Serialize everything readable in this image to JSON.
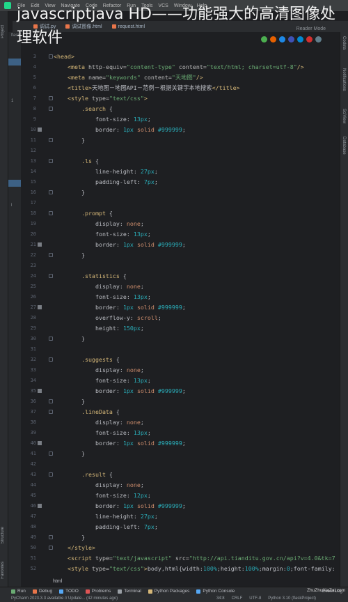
{
  "overlay_title": "javascriptjava HD——功能强大的高清图像处理软件",
  "menubar": {
    "items": [
      "File",
      "Edit",
      "View",
      "Navigate",
      "Code",
      "Refactor",
      "Run",
      "Tools",
      "VCS",
      "Window",
      "Help"
    ]
  },
  "tabs": [
    {
      "label": "调试.py"
    },
    {
      "label": "调试图像.html"
    },
    {
      "label": "request.html"
    }
  ],
  "left_strip": {
    "labels": [
      "Project",
      "Structure",
      "Favorites"
    ],
    "project_items": [
      "flaskP",
      "1",
      "l"
    ]
  },
  "right_strip": {
    "labels": [
      "Codota",
      "Notifications",
      "SciView",
      "Database"
    ]
  },
  "editor": {
    "reader_mode": "Reader Mode",
    "browser_icons": [
      "chrome-icon",
      "firefox-icon",
      "safari-icon",
      "edge-icon",
      "ie-icon",
      "opera-icon",
      "browser-icon"
    ],
    "browser_colors": [
      "#4caf50",
      "#e66000",
      "#1e88e5",
      "#3f51b5",
      "#0288d1",
      "#d32f2f",
      "#607d8b"
    ],
    "breadcrumb": "html",
    "lines": [
      {
        "n": "3",
        "fold": true,
        "bp": false,
        "html": "<span class='tag'>&lt;head&gt;</span>"
      },
      {
        "n": "4",
        "fold": false,
        "bp": false,
        "html": "    <span class='tag'>&lt;meta</span> <span class='attr'>http-equiv=</span><span class='str'>\"content-type\"</span> <span class='attr'>content=</span><span class='str'>\"text/html; charset=utf-8\"</span><span class='tag'>/&gt;</span>"
      },
      {
        "n": "5",
        "fold": false,
        "bp": false,
        "html": "    <span class='tag'>&lt;meta</span> <span class='attr'>name=</span><span class='str'>\"keywords\"</span> <span class='attr'>content=</span><span class='str'>\"天地图\"</span><span class='tag'>/&gt;</span>"
      },
      {
        "n": "6",
        "fold": false,
        "bp": false,
        "html": "    <span class='tag'>&lt;title&gt;</span>天地图－地图API－范例－根据关键字本地搜索<span class='tag'>&lt;/title&gt;</span>"
      },
      {
        "n": "7",
        "fold": true,
        "bp": false,
        "html": "    <span class='tag'>&lt;style</span> <span class='attr'>type=</span><span class='str'>\"text/css\"</span><span class='tag'>&gt;</span>"
      },
      {
        "n": "8",
        "fold": true,
        "bp": false,
        "html": "        <span class='sel'>.search</span> {"
      },
      {
        "n": "9",
        "fold": false,
        "bp": false,
        "html": "            <span class='prop'>font-size</span>: <span class='num'>13px</span>;"
      },
      {
        "n": "10",
        "fold": false,
        "bp": true,
        "html": "            <span class='prop'>border</span>: <span class='num'>1px</span> <span class='kw'>solid</span> <span class='hex'>#999999</span>;"
      },
      {
        "n": "11",
        "fold": true,
        "bp": false,
        "html": "        }"
      },
      {
        "n": "12",
        "fold": false,
        "bp": false,
        "html": ""
      },
      {
        "n": "13",
        "fold": true,
        "bp": false,
        "html": "        <span class='sel'>.ls</span> {"
      },
      {
        "n": "14",
        "fold": false,
        "bp": false,
        "html": "            <span class='prop'>line-height</span>: <span class='num'>27px</span>;"
      },
      {
        "n": "15",
        "fold": false,
        "bp": false,
        "html": "            <span class='prop'>padding-left</span>: <span class='num'>7px</span>;"
      },
      {
        "n": "16",
        "fold": true,
        "bp": false,
        "html": "        }"
      },
      {
        "n": "17",
        "fold": false,
        "bp": false,
        "html": ""
      },
      {
        "n": "18",
        "fold": true,
        "bp": false,
        "html": "        <span class='sel'>.prompt</span> {"
      },
      {
        "n": "19",
        "fold": false,
        "bp": false,
        "html": "            <span class='prop'>display</span>: <span class='kw'>none</span>;"
      },
      {
        "n": "20",
        "fold": false,
        "bp": false,
        "html": "            <span class='prop'>font-size</span>: <span class='num'>13px</span>;"
      },
      {
        "n": "21",
        "fold": false,
        "bp": true,
        "html": "            <span class='prop'>border</span>: <span class='num'>1px</span> <span class='kw'>solid</span> <span class='hex'>#999999</span>;"
      },
      {
        "n": "22",
        "fold": true,
        "bp": false,
        "html": "        }"
      },
      {
        "n": "23",
        "fold": false,
        "bp": false,
        "html": ""
      },
      {
        "n": "24",
        "fold": true,
        "bp": false,
        "html": "        <span class='sel'>.statistics</span> {"
      },
      {
        "n": "25",
        "fold": false,
        "bp": false,
        "html": "            <span class='prop'>display</span>: <span class='kw'>none</span>;"
      },
      {
        "n": "26",
        "fold": false,
        "bp": false,
        "html": "            <span class='prop'>font-size</span>: <span class='num'>13px</span>;"
      },
      {
        "n": "27",
        "fold": false,
        "bp": true,
        "html": "            <span class='prop'>border</span>: <span class='num'>1px</span> <span class='kw'>solid</span> <span class='hex'>#999999</span>;"
      },
      {
        "n": "28",
        "fold": false,
        "bp": false,
        "html": "            <span class='prop'>overflow-y</span>: <span class='kw'>scroll</span>;"
      },
      {
        "n": "29",
        "fold": false,
        "bp": false,
        "html": "            <span class='prop'>height</span>: <span class='num'>150px</span>;"
      },
      {
        "n": "30",
        "fold": true,
        "bp": false,
        "html": "        }"
      },
      {
        "n": "31",
        "fold": false,
        "bp": false,
        "html": ""
      },
      {
        "n": "32",
        "fold": true,
        "bp": false,
        "html": "        <span class='sel'>.suggests</span> {"
      },
      {
        "n": "33",
        "fold": false,
        "bp": false,
        "html": "            <span class='prop'>display</span>: <span class='kw'>none</span>;"
      },
      {
        "n": "34",
        "fold": false,
        "bp": false,
        "html": "            <span class='prop'>font-size</span>: <span class='num'>13px</span>;"
      },
      {
        "n": "35",
        "fold": false,
        "bp": true,
        "html": "            <span class='prop'>border</span>: <span class='num'>1px</span> <span class='kw'>solid</span> <span class='hex'>#999999</span>;"
      },
      {
        "n": "36",
        "fold": true,
        "bp": false,
        "html": "        }"
      },
      {
        "n": "37",
        "fold": true,
        "bp": false,
        "html": "        <span class='sel'>.lineData</span> {"
      },
      {
        "n": "38",
        "fold": false,
        "bp": false,
        "html": "            <span class='prop'>display</span>: <span class='kw'>none</span>;"
      },
      {
        "n": "39",
        "fold": false,
        "bp": false,
        "html": "            <span class='prop'>font-size</span>: <span class='num'>13px</span>;"
      },
      {
        "n": "40",
        "fold": false,
        "bp": true,
        "html": "            <span class='prop'>border</span>: <span class='num'>1px</span> <span class='kw'>solid</span> <span class='hex'>#999999</span>;"
      },
      {
        "n": "41",
        "fold": true,
        "bp": false,
        "html": "        }"
      },
      {
        "n": "42",
        "fold": false,
        "bp": false,
        "html": ""
      },
      {
        "n": "43",
        "fold": true,
        "bp": false,
        "html": "        <span class='sel'>.result</span> {"
      },
      {
        "n": "44",
        "fold": false,
        "bp": false,
        "html": "            <span class='prop'>display</span>: <span class='kw'>none</span>;"
      },
      {
        "n": "45",
        "fold": false,
        "bp": false,
        "html": "            <span class='prop'>font-size</span>: <span class='num'>12px</span>;"
      },
      {
        "n": "46",
        "fold": false,
        "bp": true,
        "html": "            <span class='prop'>border</span>: <span class='num'>1px</span> <span class='kw'>solid</span> <span class='hex'>#999999</span>;"
      },
      {
        "n": "47",
        "fold": false,
        "bp": false,
        "html": "            <span class='prop'>line-height</span>: <span class='num'>27px</span>;"
      },
      {
        "n": "48",
        "fold": false,
        "bp": false,
        "html": "            <span class='prop'>padding-left</span>: <span class='num'>7px</span>;"
      },
      {
        "n": "49",
        "fold": true,
        "bp": false,
        "html": "        }"
      },
      {
        "n": "50",
        "fold": true,
        "bp": false,
        "html": "    <span class='tag'>&lt;/style&gt;</span>"
      },
      {
        "n": "51",
        "fold": false,
        "bp": false,
        "html": "    <span class='tag'>&lt;script</span> <span class='attr'>type=</span><span class='str'>\"text/javascript\"</span> <span class='attr'>src=</span><span class='str'>\"http://api.tianditu.gov.cn/api?v=4.0&amp;tk=7</span>"
      },
      {
        "n": "52",
        "fold": false,
        "bp": false,
        "html": "    <span class='tag'>&lt;style</span> <span class='attr'>type=</span><span class='str'>\"text/css\"</span><span class='tag'>&gt;</span>body,html{width:<span class='num'>100%</span>;height:<span class='num'>100%</span>;margin:<span class='num'>0</span>;font-family:"
      }
    ]
  },
  "bottom_tools": {
    "items": [
      "Run",
      "Debug",
      "TODO",
      "Problems",
      "Terminal",
      "Python Packages",
      "Python Console"
    ],
    "right": "Event Log"
  },
  "statusbar": {
    "message": "PyCharm 2023.3.3 available // Update... (42 minutes ago)",
    "position": "34:8",
    "line_sep": "CRLF",
    "encoding": "UTF-8",
    "interpreter": "Python 3.10 (flaskProject)"
  },
  "watermark": "ZhuZhuXiaZai.com"
}
